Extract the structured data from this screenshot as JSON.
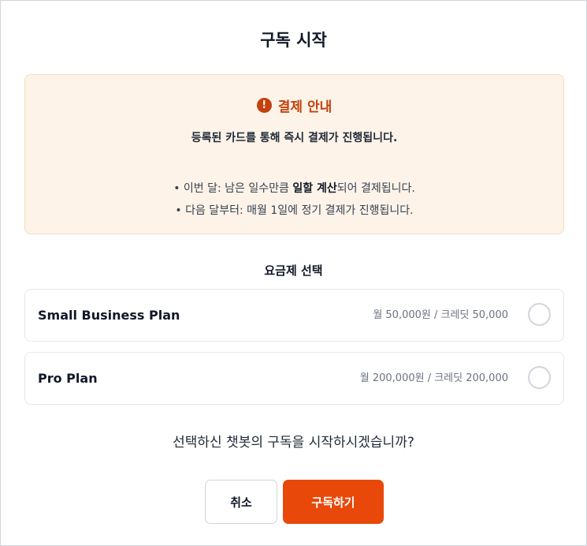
{
  "dialog": {
    "title": "구독 시작"
  },
  "notice": {
    "icon": "alert-circle-icon",
    "heading": "결제 안내",
    "subheading": "등록된 카드를 통해 즉시 결제가 진행됩니다.",
    "bullet1_prefix": "• 이번 달: 남은 일수만큼 ",
    "bullet1_bold": "일할 계산",
    "bullet1_suffix": "되어 결제됩니다.",
    "bullet2": "• 다음 달부터: 매월 1일에 정기 결제가 진행됩니다.",
    "accent_color": "#c2410c",
    "background_color": "#fdf3e8"
  },
  "plans": {
    "section_label": "요금제 선택",
    "items": [
      {
        "name": "Small Business Plan",
        "price": "월 50,000원 / 크레딧 50,000",
        "selected": false
      },
      {
        "name": "Pro Plan",
        "price": "월 200,000원 / 크레딧 200,000",
        "selected": false
      }
    ]
  },
  "confirm": {
    "question": "선택하신 챗봇의 구독을 시작하시겠습니까?"
  },
  "buttons": {
    "cancel": "취소",
    "submit": "구독하기",
    "submit_color": "#e8490b"
  }
}
